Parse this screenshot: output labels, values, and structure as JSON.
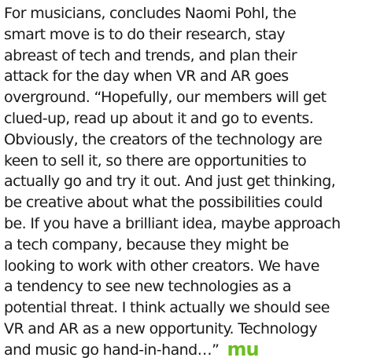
{
  "article": {
    "lines": [
      "For musicians, concludes Naomi Pohl, the",
      "smart move is to do their research, stay",
      "abreast of tech and trends, and plan their",
      "attack for the day when VR and AR goes",
      "overground. “Hopefully, our members will get",
      "clued-up, read up about it and go to events.",
      "Obviously, the creators of the technology are",
      "keen to sell it, so there are opportunities to",
      "actually go and try it out. And just get thinking,",
      "be creative about what the possibilities could",
      "be. If you have a brilliant idea, maybe approach",
      "a tech company, because they might be",
      "looking to work with other creators. We have",
      "a tendency to see new technologies as a",
      "potential threat. I think actually we should see",
      "VR and AR as a new opportunity. Technology",
      "and music go hand-in-hand…”"
    ],
    "end_mark": "mu",
    "end_mark_color": "#6abf1e",
    "text_color": "#1a1a1a"
  }
}
